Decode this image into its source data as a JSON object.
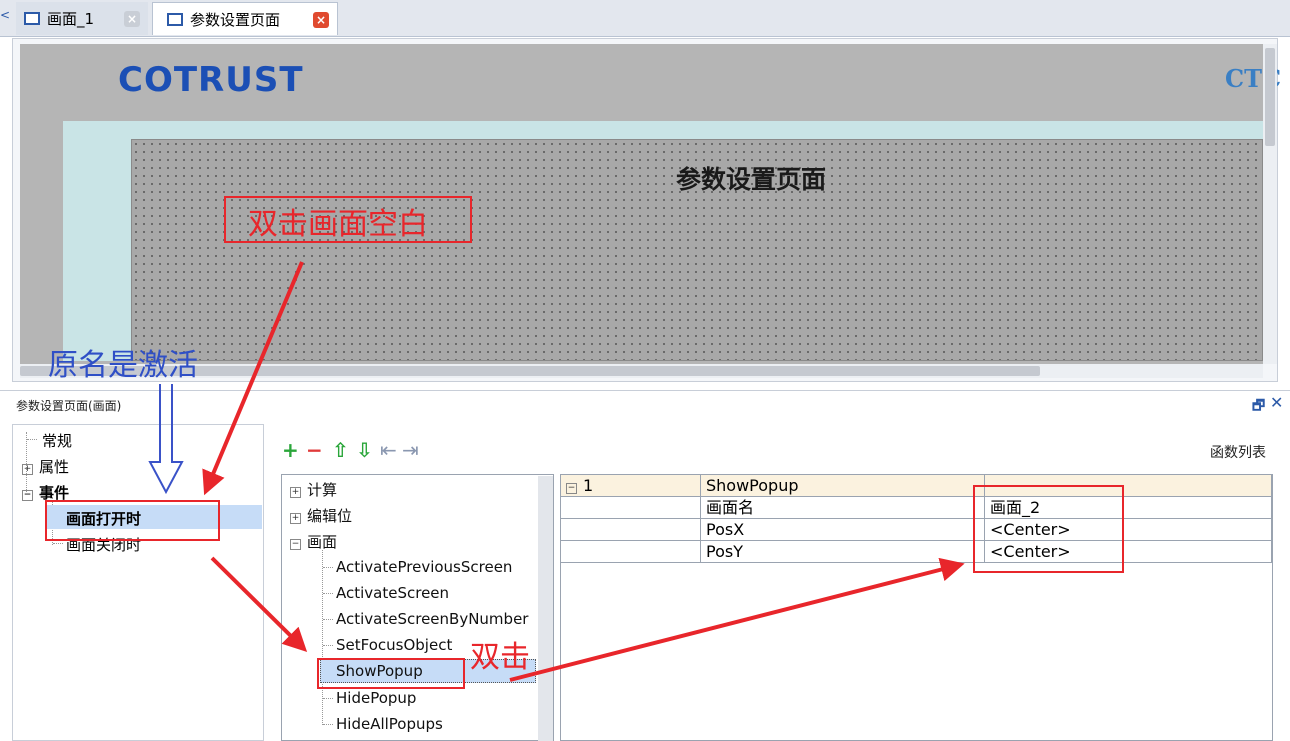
{
  "tabs": [
    {
      "label": "画面_1",
      "close": "×"
    },
    {
      "label": "参数设置页面",
      "close": "×"
    }
  ],
  "canvas": {
    "logo": "COTRUST",
    "logo_right": "CTC",
    "screen_title": "参数设置页面"
  },
  "panel": {
    "title": "参数设置页面(画面)",
    "restore": "🗗",
    "close": "✕"
  },
  "left_tree": {
    "items": [
      {
        "label": "常规",
        "expander": ""
      },
      {
        "label": "属性",
        "expander": "+"
      },
      {
        "label": "事件",
        "expander": "−"
      },
      {
        "label": "画面打开时",
        "expander": ""
      },
      {
        "label": "画面关闭时",
        "expander": ""
      }
    ]
  },
  "toolbar": {
    "add": "+",
    "remove": "−",
    "up": "⇧",
    "down": "⇩",
    "indent": "⇤",
    "outdent": "⇥",
    "func_list_label": "函数列表"
  },
  "func_tree": {
    "groups": [
      {
        "label": "计算",
        "expander": "+"
      },
      {
        "label": "编辑位",
        "expander": "+"
      },
      {
        "label": "画面",
        "expander": "−"
      }
    ],
    "items": [
      "ActivatePreviousScreen",
      "ActivateScreen",
      "ActivateScreenByNumber",
      "SetFocusObject",
      "ShowPopup",
      "HidePopup",
      "HideAllPopups"
    ]
  },
  "grid": {
    "row_num": "1",
    "row_expander": "−",
    "function": "ShowPopup",
    "params": [
      {
        "name": "画面名",
        "value": "画面_2"
      },
      {
        "name": "PosX",
        "value": "<Center>"
      },
      {
        "name": "PosY",
        "value": "<Center>"
      }
    ]
  },
  "annotations": {
    "double_click_blank": "双击画面空白",
    "original_name": "原名是激活",
    "double_click": "双击"
  },
  "colors": {
    "accent_blue": "#1b4fb5",
    "annotation_red": "#e8262b",
    "annotation_blue": "#2f4fc6",
    "selection": "#c6dcf7"
  }
}
